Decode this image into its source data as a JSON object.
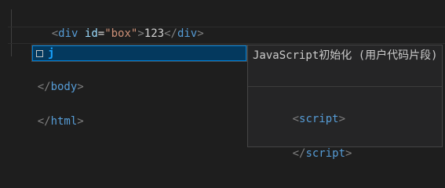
{
  "editor": {
    "lines": {
      "line1": {
        "open_bracket": "<",
        "tag": "div",
        "attr": "id",
        "equals": "=",
        "value": "\"box\"",
        "close_bracket": ">",
        "content": "123",
        "end_open": "</",
        "end_tag": "div",
        "end_close": ">"
      },
      "line2": {
        "typed": "j"
      },
      "line4": {
        "open": "</",
        "tag": "body",
        "close": ">"
      },
      "line6": {
        "open": "</",
        "tag": "html",
        "close": ">"
      }
    }
  },
  "suggestion": {
    "icon": "snippet-icon",
    "label": "j",
    "selected": true
  },
  "details": {
    "title": "JavaScript初始化 (用户代码片段)",
    "code_open": {
      "lt": "<",
      "tag": "script",
      "gt": ">"
    },
    "code_close": {
      "lt": "</",
      "tag": "script",
      "gt": ">"
    }
  },
  "colors": {
    "background": "#1e1e1e",
    "tag": "#569cd6",
    "attribute": "#9cdcfe",
    "string": "#ce9178",
    "punctuation": "#808080",
    "suggest_highlight": "#04395e",
    "suggest_border": "#007fd4",
    "match_text": "#18a3ff"
  }
}
